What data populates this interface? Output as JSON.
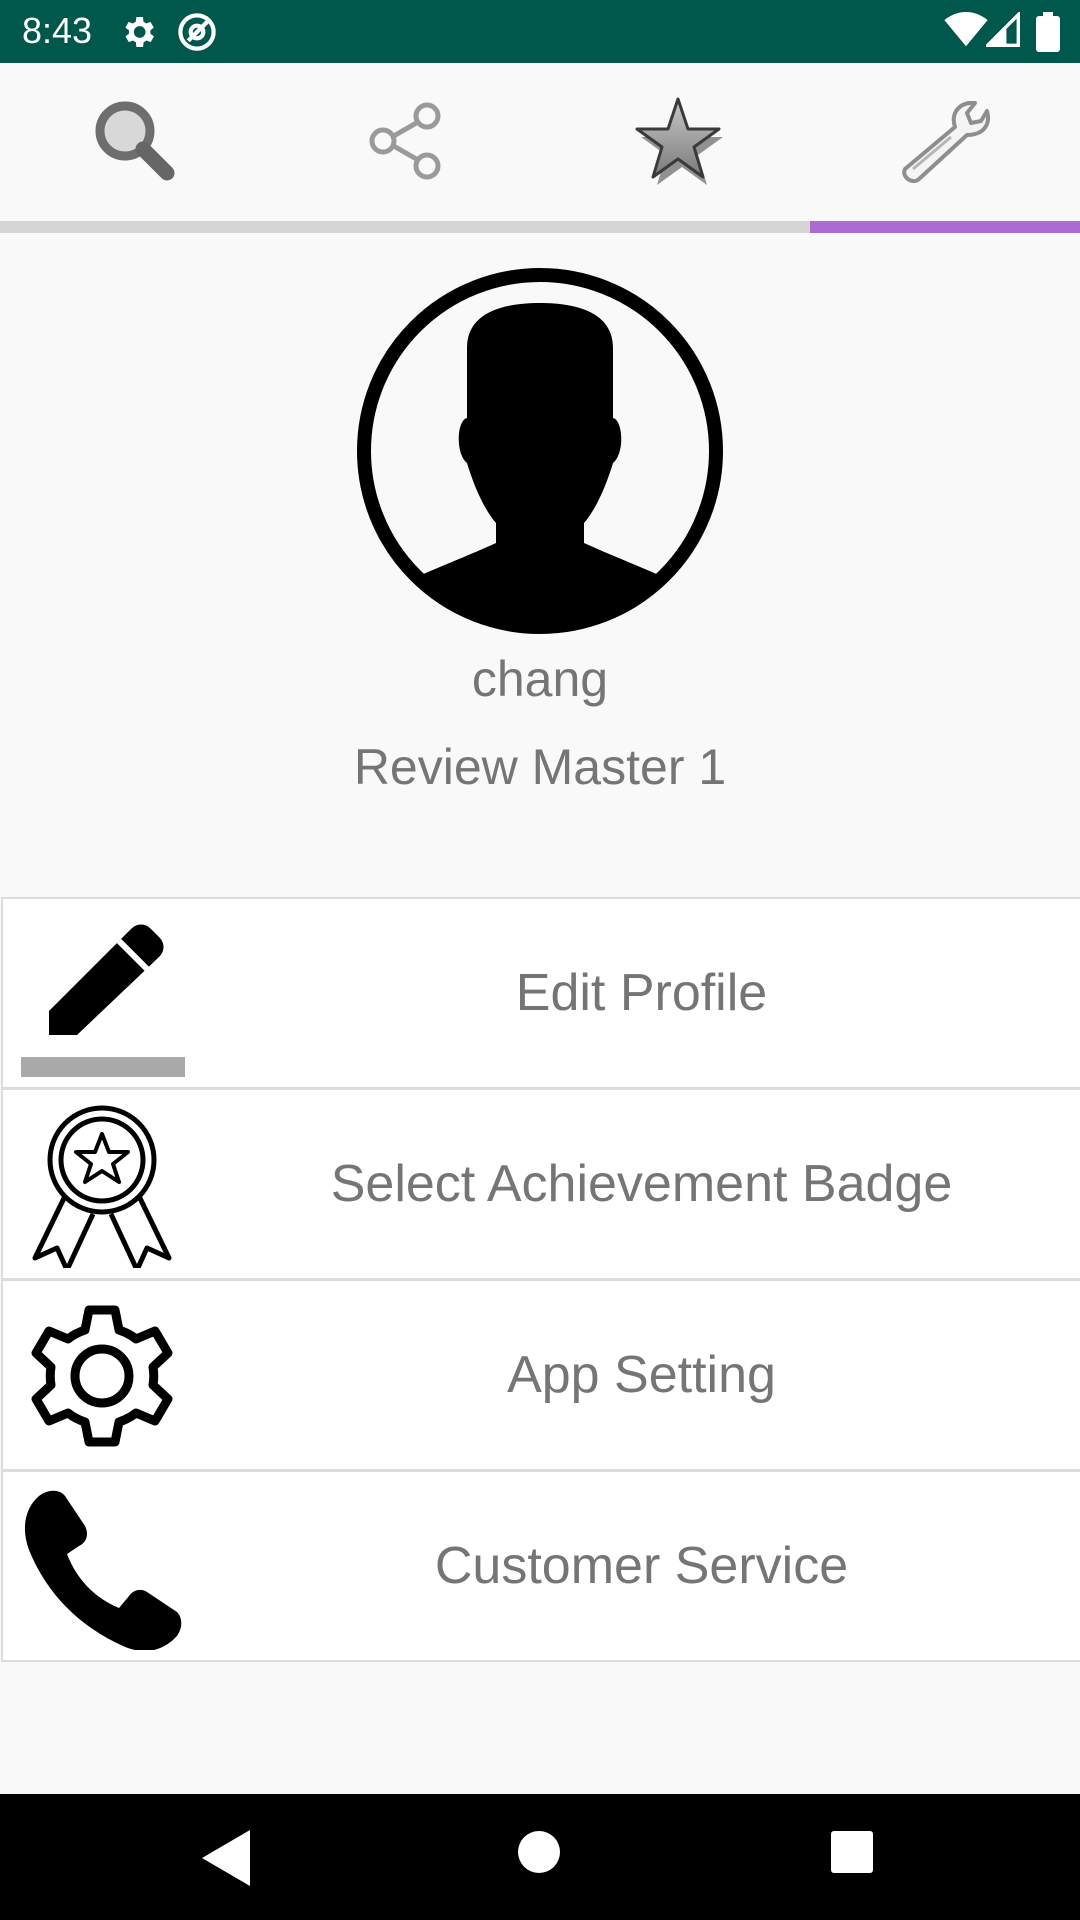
{
  "status_bar": {
    "time": "8:43",
    "icons": [
      "gear-icon",
      "at-icon",
      "wifi-icon",
      "signal-icon",
      "battery-icon"
    ],
    "background": "#00574b"
  },
  "tabs": [
    {
      "icon": "search-icon",
      "selected": false
    },
    {
      "icon": "share-icon",
      "selected": false
    },
    {
      "icon": "star-icon",
      "selected": false
    },
    {
      "icon": "wrench-icon",
      "selected": true
    }
  ],
  "accent_color": "#ab6bd1",
  "profile": {
    "avatar_icon": "user-silhouette-icon",
    "username": "chang",
    "rank": "Review Master 1"
  },
  "menu": [
    {
      "icon": "pencil-icon",
      "label": "Edit Profile"
    },
    {
      "icon": "badge-icon",
      "label": "Select Achievement Badge"
    },
    {
      "icon": "gear-icon",
      "label": "App Setting"
    },
    {
      "icon": "phone-icon",
      "label": "Customer Service"
    }
  ],
  "nav_bar": {
    "icons": [
      "back-icon",
      "home-icon",
      "recents-icon"
    ]
  }
}
